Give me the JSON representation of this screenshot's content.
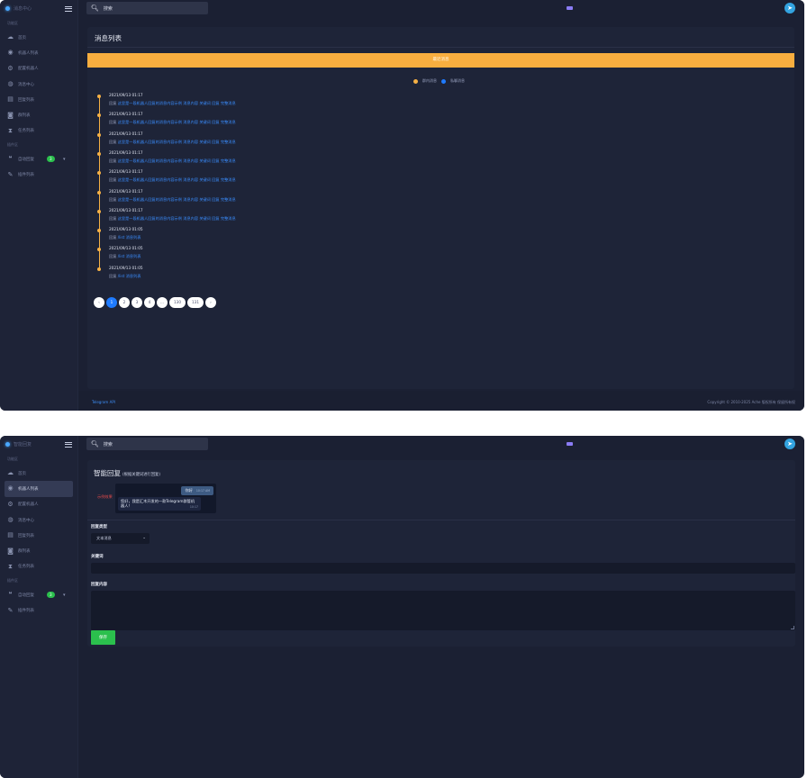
{
  "brand": "消息中心",
  "sidebar": {
    "group1": "功能区",
    "group2": "插件区",
    "items": [
      {
        "label": "首页",
        "icon": "cloud-icon"
      },
      {
        "label": "机器人列表",
        "icon": "robot-icon"
      },
      {
        "label": "配置机器人",
        "icon": "cogs-icon"
      },
      {
        "label": "消息中心",
        "icon": "message-icon"
      },
      {
        "label": "回复列表",
        "icon": "list-icon"
      },
      {
        "label": "群列表",
        "icon": "database-icon"
      },
      {
        "label": "任务列表",
        "icon": "hourglass-icon"
      }
    ],
    "plugin_items": [
      {
        "label": "自动回复",
        "icon": "comments-icon",
        "badge": "3"
      },
      {
        "label": "插件列表",
        "icon": "puzzle-icon"
      }
    ]
  },
  "search": {
    "placeholder": "搜索"
  },
  "screen1": {
    "title": "消息列表",
    "banner": "最近消息",
    "legend": [
      {
        "label": "群内消息",
        "color": "#f5b045"
      },
      {
        "label": "私聊消息",
        "color": "#1f7bff"
      }
    ],
    "timeline": [
      {
        "time": "2021/09/13 01:17",
        "prefix": "回复",
        "content": "这里是一段机器人回复的消息内容示例 消息内容 关键词 回复 完整消息"
      },
      {
        "time": "2021/09/13 01:17",
        "prefix": "回复",
        "content": "这里是一段机器人回复的消息内容示例 消息内容 关键词 回复 完整消息"
      },
      {
        "time": "2021/09/13 01:17",
        "prefix": "回复",
        "content": "这里是一段机器人回复的消息内容示例 消息内容 关键词 回复 完整消息"
      },
      {
        "time": "2021/09/13 01:17",
        "prefix": "回复",
        "content": "这里是一段机器人回复的消息内容示例 消息内容 关键词 回复 完整消息"
      },
      {
        "time": "2021/09/13 01:17",
        "prefix": "回复",
        "content": "这里是一段机器人回复的消息内容示例 消息内容 关键词 回复 完整消息"
      },
      {
        "time": "2021/09/13 01:17",
        "prefix": "回复",
        "content": "这里是一段机器人回复的消息内容示例 消息内容 关键词 回复 完整消息"
      },
      {
        "time": "2021/09/13 01:17",
        "prefix": "回复",
        "content": "这里是一段机器人回复的消息内容示例 消息内容 关键词 回复 完整消息"
      },
      {
        "time": "2021/09/13 01:05",
        "prefix": "回复",
        "content": "/list 消息列表"
      },
      {
        "time": "2021/09/13 01:05",
        "prefix": "回复",
        "content": "/list 消息列表"
      },
      {
        "time": "2021/09/13 01:05",
        "prefix": "回复",
        "content": "/list 消息列表"
      }
    ],
    "pagination": [
      "‹",
      "1",
      "2",
      "3",
      "4",
      "…",
      "130",
      "131",
      "›"
    ],
    "footer_left": "Telegram API",
    "footer_right": "Copyright © 2010-2025 Ache 版权所有 保留所有权"
  },
  "screen2": {
    "brand": "智能回复",
    "title": "智能回复",
    "subtitle": "(根据关键词进行回复)",
    "preview_label": "示例效果",
    "chat_question": "你好",
    "chat_question_time": "10:17 AM",
    "chat_answer": "您好，我是汇木开发的一款Telegram群管机器人！",
    "chat_answer_time": "10:17",
    "type_label": "回复类型",
    "type_value": "文本消息",
    "keyword_label": "关键词",
    "content_label": "回复内容",
    "save_label": "保存"
  }
}
